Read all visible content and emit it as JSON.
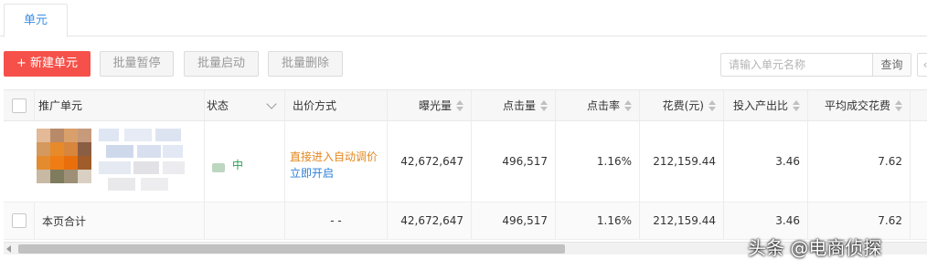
{
  "tabs": [
    {
      "label": "单元",
      "active": true
    }
  ],
  "toolbar": {
    "new_label": "+ 新建单元",
    "pause_label": "批量暂停",
    "start_label": "批量启动",
    "delete_label": "批量删除"
  },
  "search": {
    "placeholder": "请输入单元名称",
    "button_label": "查询"
  },
  "table": {
    "columns": [
      "推广单元",
      "状态",
      "出价方式",
      "曝光量",
      "点击量",
      "点击率",
      "花费(元)",
      "投入产出比",
      "平均成交花费"
    ],
    "rows": [
      {
        "status": "中",
        "bid_line1": "直接进入自动调价",
        "bid_line2": "立即开启",
        "impressions": "42,672,647",
        "clicks": "496,517",
        "ctr": "1.16%",
        "cost": "212,159.44",
        "roi": "3.46",
        "avg_cost": "7.62"
      }
    ],
    "total": {
      "label": "本页合计",
      "bid": "- -",
      "impressions": "42,672,647",
      "clicks": "496,517",
      "ctr": "1.16%",
      "cost": "212,159.44",
      "roi": "3.46",
      "avg_cost": "7.62"
    }
  },
  "watermark": "头条 @电商侦探",
  "colors": {
    "accent": "#f5514a",
    "tab_active": "#3a8ee6",
    "status": "#2e9d52",
    "bid_orange": "#e2871d",
    "bid_blue": "#2d7fd5"
  }
}
